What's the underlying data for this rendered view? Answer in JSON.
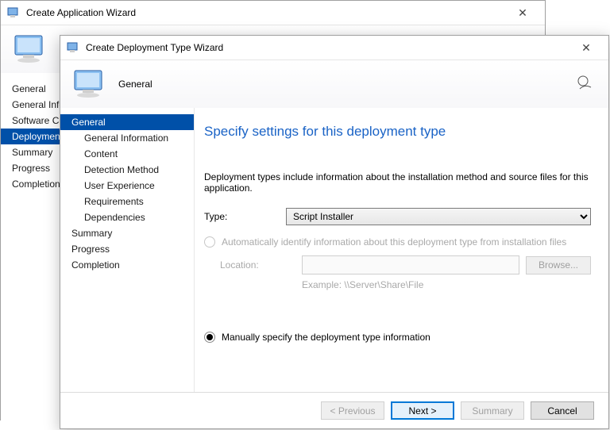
{
  "backgroundWizard": {
    "title": "Create Application Wizard",
    "nav": [
      "General",
      "General Information",
      "Software Center",
      "Deployment Types",
      "Summary",
      "Progress",
      "Completion"
    ],
    "selectedIndex": 3
  },
  "foregroundWizard": {
    "title": "Create Deployment Type Wizard",
    "bannerTitle": "General",
    "nav": [
      {
        "label": "General",
        "level": 0,
        "selected": true
      },
      {
        "label": "General Information",
        "level": 1,
        "selected": false
      },
      {
        "label": "Content",
        "level": 1,
        "selected": false
      },
      {
        "label": "Detection Method",
        "level": 1,
        "selected": false
      },
      {
        "label": "User Experience",
        "level": 1,
        "selected": false
      },
      {
        "label": "Requirements",
        "level": 1,
        "selected": false
      },
      {
        "label": "Dependencies",
        "level": 1,
        "selected": false
      },
      {
        "label": "Summary",
        "level": 0,
        "selected": false
      },
      {
        "label": "Progress",
        "level": 0,
        "selected": false
      },
      {
        "label": "Completion",
        "level": 0,
        "selected": false
      }
    ],
    "page": {
      "heading": "Specify settings for this deployment type",
      "description": "Deployment types include information about the installation method and source files for this application.",
      "typeLabel": "Type:",
      "typeValue": "Script Installer",
      "autoRadio": "Automatically identify information about this deployment type from installation files",
      "locationLabel": "Location:",
      "locationValue": "",
      "browseLabel": "Browse...",
      "exampleText": "Example: \\\\Server\\Share\\File",
      "manualRadio": "Manually specify the deployment type information"
    },
    "footer": {
      "previous": "< Previous",
      "next": "Next >",
      "summary": "Summary",
      "cancel": "Cancel"
    }
  }
}
